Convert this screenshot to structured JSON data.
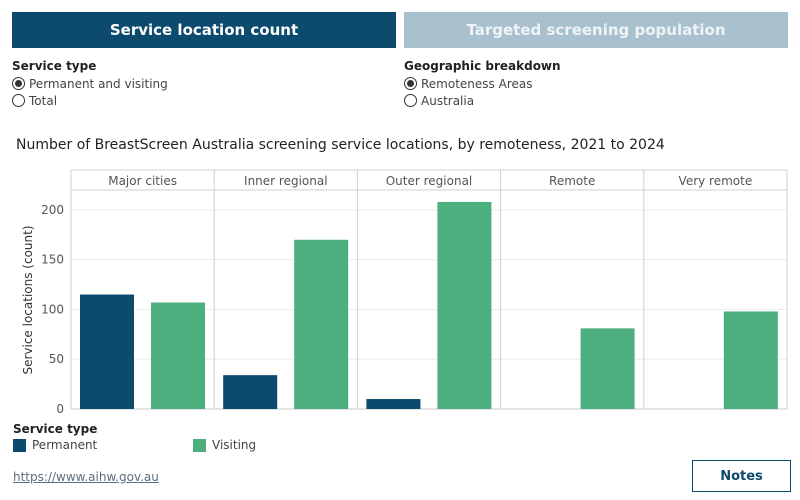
{
  "tabs": [
    {
      "label": "Service location count",
      "active": true
    },
    {
      "label": "Targeted screening population",
      "active": false
    }
  ],
  "service_type_control": {
    "title": "Service type",
    "options": [
      {
        "label": "Permanent and visiting",
        "selected": true
      },
      {
        "label": "Total",
        "selected": false
      }
    ]
  },
  "geo_control": {
    "title": "Geographic breakdown",
    "options": [
      {
        "label": "Remoteness Areas",
        "selected": true
      },
      {
        "label": "Australia",
        "selected": false
      }
    ]
  },
  "colors": {
    "permanent": "#0c4a6e",
    "visiting": "#4caf7d",
    "tab_active": "#0c4a6e",
    "tab_inactive": "#a9c1cf"
  },
  "chart_data": {
    "type": "bar",
    "title": "Number of BreastScreen Australia screening service locations, by remoteness, 2021 to 2024",
    "ylabel": "Service locations (count)",
    "xlabel": "",
    "categories": [
      "Major cities",
      "Inner regional",
      "Outer regional",
      "Remote",
      "Very remote"
    ],
    "series": [
      {
        "name": "Permanent",
        "values": [
          115,
          34,
          10,
          0,
          0
        ]
      },
      {
        "name": "Visiting",
        "values": [
          107,
          170,
          208,
          81,
          98
        ]
      }
    ],
    "ylim": [
      0,
      220
    ],
    "yticks": [
      0,
      50,
      100,
      150,
      200
    ],
    "grid": true,
    "legend": {
      "title": "Service type",
      "placement": "bottom-left"
    }
  },
  "footer": {
    "link_text": "https://www.aihw.gov.au",
    "notes_label": "Notes"
  }
}
